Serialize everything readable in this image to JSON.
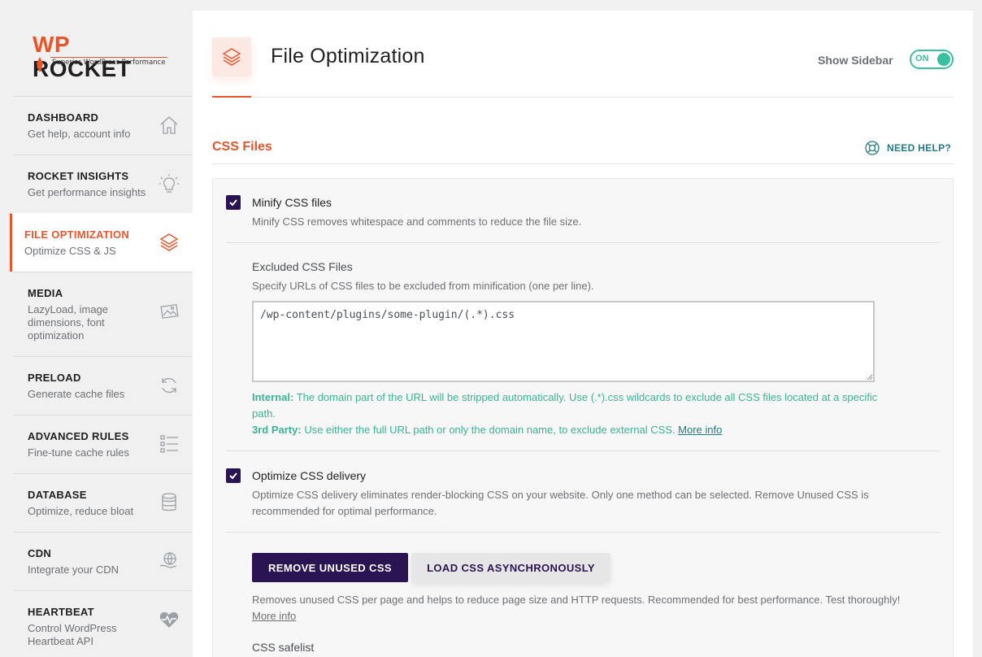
{
  "logo": {
    "wp": "WP",
    "rocket": "ROCKET",
    "tagline": "Superior WordPress Performance"
  },
  "nav": [
    {
      "title": "DASHBOARD",
      "subtitle": "Get help, account info",
      "icon": "home-icon"
    },
    {
      "title": "ROCKET INSIGHTS",
      "subtitle": "Get performance insights",
      "icon": "lightbulb-icon"
    },
    {
      "title": "FILE OPTIMIZATION",
      "subtitle": "Optimize CSS & JS",
      "icon": "layers-icon",
      "active": true
    },
    {
      "title": "MEDIA",
      "subtitle": "LazyLoad, image dimensions, font optimization",
      "icon": "images-icon"
    },
    {
      "title": "PRELOAD",
      "subtitle": "Generate cache files",
      "icon": "refresh-icon"
    },
    {
      "title": "ADVANCED RULES",
      "subtitle": "Fine-tune cache rules",
      "icon": "checklist-icon"
    },
    {
      "title": "DATABASE",
      "subtitle": "Optimize, reduce bloat",
      "icon": "database-icon"
    },
    {
      "title": "CDN",
      "subtitle": "Integrate your CDN",
      "icon": "globe-hand-icon"
    },
    {
      "title": "HEARTBEAT",
      "subtitle": "Control WordPress Heartbeat API",
      "icon": "heartbeat-icon"
    }
  ],
  "header": {
    "title": "File Optimization",
    "show_sidebar_label": "Show Sidebar",
    "toggle_label": "ON",
    "toggle_on": true
  },
  "section": {
    "title": "CSS Files",
    "need_help": "NEED HELP?"
  },
  "minify": {
    "checked": true,
    "title": "Minify CSS files",
    "description": "Minify CSS removes whitespace and comments to reduce the file size."
  },
  "excluded": {
    "title": "Excluded CSS Files",
    "description": "Specify URLs of CSS files to be excluded from minification (one per line).",
    "value": "/wp-content/plugins/some-plugin/(.*).css",
    "internal_label": "Internal:",
    "internal_text": "The domain part of the URL will be stripped automatically. Use (.*).css wildcards to exclude all CSS files located at a specific path.",
    "third_label": "3rd Party:",
    "third_text": "Use either the full URL path or only the domain name, to exclude external CSS.",
    "more_info": "More info"
  },
  "optimize": {
    "checked": true,
    "title": "Optimize CSS delivery",
    "description": "Optimize CSS delivery eliminates render-blocking CSS on your website. Only one method can be selected. Remove Unused CSS is recommended for optimal performance.",
    "btn_remove": "REMOVE UNUSED CSS",
    "btn_async": "LOAD CSS ASYNCHRONOUSLY",
    "remove_desc": "Removes unused CSS per page and helps to reduce page size and HTTP requests. Recommended for best performance. Test thoroughly!",
    "more_info": "More info",
    "safelist_title": "CSS safelist"
  },
  "colors": {
    "accent": "#e8552a",
    "primary": "#2a1452",
    "success": "#3ac09e",
    "teal": "#237b84"
  }
}
